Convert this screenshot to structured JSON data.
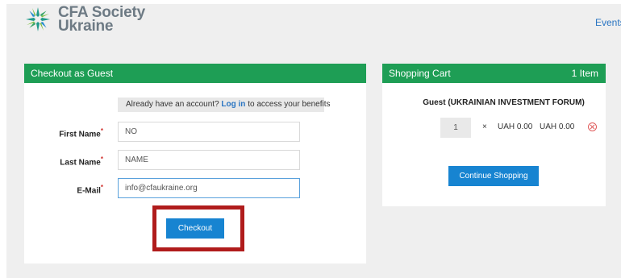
{
  "header": {
    "logo_line1": "CFA Society",
    "logo_line2": "Ukraine",
    "nav_events": "Events"
  },
  "guest_checkout": {
    "title": "Checkout as Guest",
    "login_prompt": "Already have an account?",
    "login_link": "Log in",
    "login_suffix": "to access your benefits",
    "fields": {
      "first_name": {
        "label": "First Name",
        "value": "NO"
      },
      "last_name": {
        "label": "Last Name",
        "value": "NAME"
      },
      "email": {
        "label": "E-Mail",
        "value": "info@cfaukraine.org"
      }
    },
    "required_mark": "*",
    "checkout_button": "Checkout"
  },
  "cart": {
    "title": "Shopping Cart",
    "item_count": "1 Item",
    "item_name": "Guest (UKRAINIAN INVESTMENT FORUM)",
    "quantity": "1",
    "times": "×",
    "unit_price": "UAH 0.00",
    "total_price": "UAH 0.00",
    "continue_button": "Continue Shopping"
  },
  "colors": {
    "header_green": "#1e9e55",
    "button_blue": "#1784d1",
    "link_blue": "#2a75c2",
    "highlight_red": "#b01c1c"
  }
}
